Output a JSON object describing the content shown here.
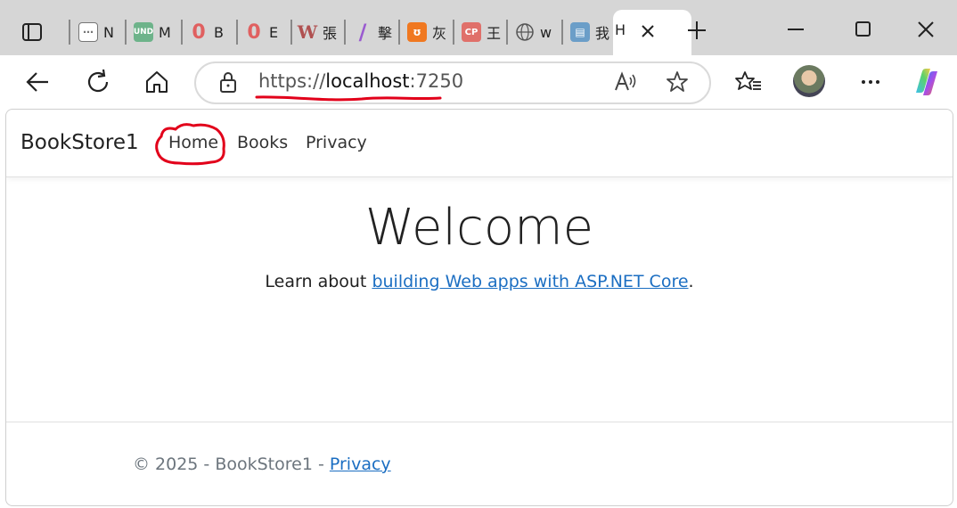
{
  "browser": {
    "tabs": [
      {
        "icon": "calendar-icon",
        "label": "N"
      },
      {
        "icon": "und-icon",
        "label": "M"
      },
      {
        "icon": "red-o-icon",
        "label": "B"
      },
      {
        "icon": "red-o-icon",
        "label": "E"
      },
      {
        "icon": "w-icon",
        "label": "張"
      },
      {
        "icon": "slash-icon",
        "label": "擊"
      },
      {
        "icon": "orange-icon",
        "label": "灰"
      },
      {
        "icon": "cp-icon",
        "label": "王"
      },
      {
        "icon": "globe-icon",
        "label": "w"
      },
      {
        "icon": "doc-icon",
        "label": "我"
      }
    ],
    "active_tab": {
      "label": "H"
    },
    "address": {
      "scheme": "https://",
      "host": "localhost",
      "port": ":7250"
    }
  },
  "site": {
    "brand": "BookStore1",
    "nav": {
      "home": "Home",
      "books": "Books",
      "privacy": "Privacy"
    },
    "heading": "Welcome",
    "learn_prefix": "Learn about ",
    "learn_link": "building Web apps with ASP.NET Core",
    "learn_suffix": ".",
    "footer_prefix": "© 2025 - BookStore1 - ",
    "footer_link": "Privacy"
  },
  "colors": {
    "link": "#1b6ec2",
    "annotation": "#e2001a"
  }
}
